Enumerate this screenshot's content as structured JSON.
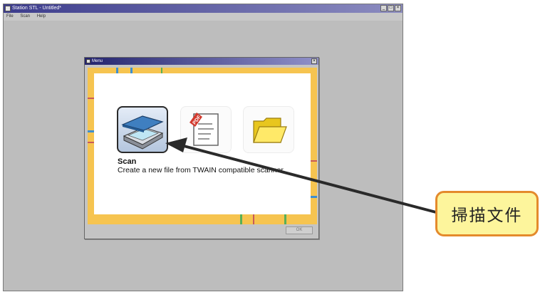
{
  "app": {
    "title": "Station STL - Untitled*",
    "menu": [
      "File",
      "Scan",
      "Help"
    ],
    "controls": [
      "_",
      "□",
      "×"
    ]
  },
  "dialog": {
    "title": "Menu",
    "close": "×",
    "options": [
      {
        "name": "Scan",
        "icon": "scanner-icon",
        "selected": true
      },
      {
        "name": "PDF",
        "icon": "pdf-document-icon",
        "selected": false
      },
      {
        "name": "Open",
        "icon": "folder-icon",
        "selected": false
      }
    ],
    "description": {
      "title": "Scan",
      "text": "Create a new file from TWAIN compatible scanner."
    },
    "pdf_badge": "PDF",
    "ok_label": "OK"
  },
  "callout": {
    "text": "掃描文件"
  },
  "colors": {
    "frame": "#f6c450",
    "callout_fill": "#fdf59c",
    "callout_border": "#e48a2c",
    "arrow": "#2a2a2a"
  }
}
